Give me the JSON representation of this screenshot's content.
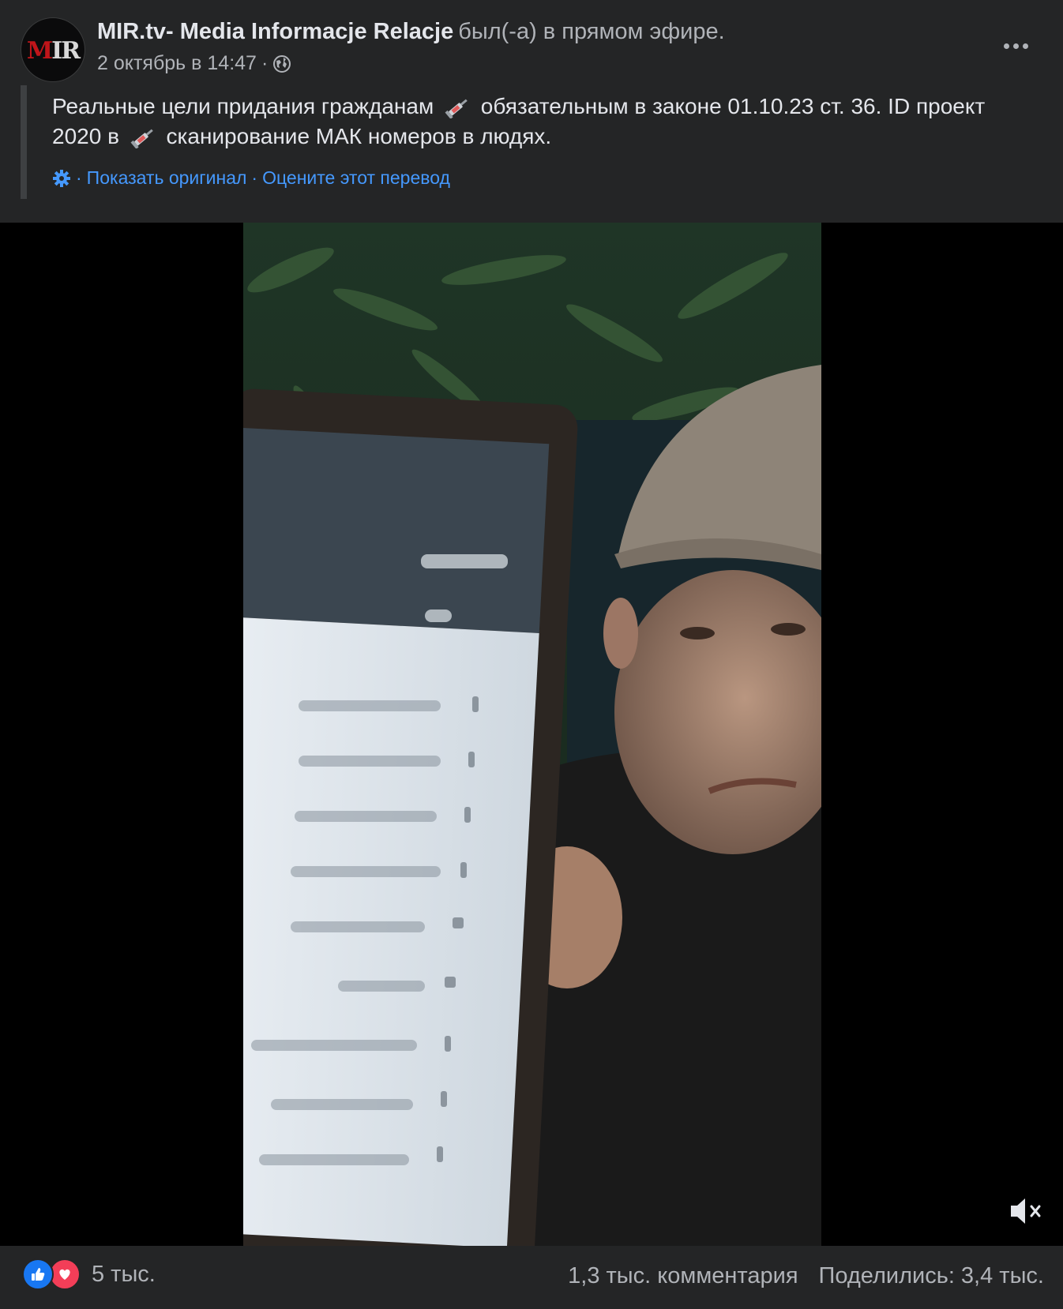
{
  "post": {
    "avatar_text": "MIR",
    "page_name": "MIR.tv- Media Informacje Relacje",
    "live_text": "был(-а) в прямом эфире.",
    "date": "2 октябрь в 14:47",
    "date_separator": "·",
    "privacy_icon": "globe-icon",
    "more_icon": "more-options-icon",
    "text_part1": "Реальные цели придания гражданам",
    "text_part2": "обязательным в законе 01.10.23 ст. 36. ID проект 2020 в",
    "text_part3": "сканирование МАК номеров в людях.",
    "emoji_icon": "syringe-emoji-icon",
    "translation": {
      "settings_icon": "gear-icon",
      "sep": "·",
      "show_original": "Показать оригинал",
      "rate_translation": "Оцените этот перевод"
    }
  },
  "video": {
    "description": "live video frame",
    "mute_icon": "muted-speaker-icon"
  },
  "footer": {
    "reaction_icons": [
      "like-icon",
      "love-icon"
    ],
    "reaction_count": "5 тыс.",
    "comments": "1,3 тыс. комментария",
    "shares": "Поделились: 3,4 тыс."
  },
  "colors": {
    "background": "#242526",
    "link": "#4599ff",
    "secondary_text": "#b0b3b8",
    "like": "#1877f2",
    "love": "#f33e58"
  }
}
